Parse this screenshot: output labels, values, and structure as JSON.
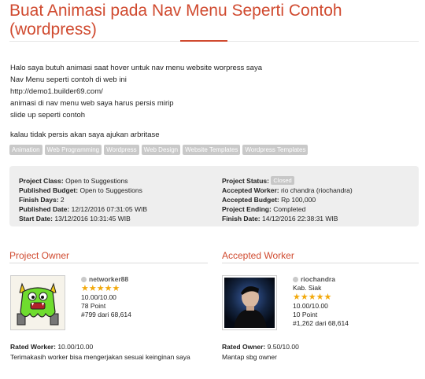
{
  "title": {
    "line1": "Buat Animasi pada Nav Menu Seperti Contoh",
    "line2": "(wordpress)"
  },
  "description": {
    "lines": [
      "Halo saya butuh animasi saat hover untuk nav menu website worpress saya",
      "Nav Menu seperti contoh di web ini",
      "http://demo1.builder69.com/",
      "animasi di nav menu web saya harus persis mirip",
      "slide up seperti contoh"
    ],
    "closing": "kalau tidak persis akan saya ajukan arbritase"
  },
  "tags": [
    "Animation",
    "Web Programming",
    "Wordpress",
    "Web Design",
    "Website Templates",
    "Wordpress Templates"
  ],
  "project_info": {
    "left": [
      {
        "label": "Project Class:",
        "value": "Open to Suggestions"
      },
      {
        "label": "Published Budget:",
        "value": "Open to Suggestions"
      },
      {
        "label": "Finish Days:",
        "value": "2"
      },
      {
        "label": "Published Date:",
        "value": "12/12/2016 07:31:05 WIB"
      },
      {
        "label": "Start Date:",
        "value": "13/12/2016 10:31:45 WIB"
      }
    ],
    "right": [
      {
        "label": "Project Status:",
        "value": "Closed"
      },
      {
        "label": "Accepted Worker:",
        "value": "rio chandra (riochandra)"
      },
      {
        "label": "Accepted Budget:",
        "value": "Rp 100,000"
      },
      {
        "label": "Project Ending:",
        "value": "Completed"
      },
      {
        "label": "Finish Date:",
        "value": "14/12/2016 22:38:31 WIB"
      }
    ]
  },
  "owner": {
    "section_title": "Project Owner",
    "username": "networker88",
    "location": "",
    "stars": "★★★★★",
    "rating": "10.00/10.00",
    "points": "78 Point",
    "rank": "#799 dari 68,614",
    "rated_label": "Rated Worker:",
    "rated_value": "10.00/10.00",
    "comment": "Terimakasih worker bisa mengerjakan sesuai keinginan saya"
  },
  "worker": {
    "section_title": "Accepted Worker",
    "username": "riochandra",
    "location": "Kab. Siak",
    "stars": "★★★★★",
    "rating": "10.00/10.00",
    "points": "10 Point",
    "rank": "#1,262 dari 68,614",
    "rated_label": "Rated Owner:",
    "rated_value": "9.50/10.00",
    "comment": "Mantap sbg owner"
  },
  "colors": {
    "accent": "#d04a2f",
    "tag_bg": "#c9c9c9",
    "panel_bg": "#eeeeee",
    "star": "#f2a90c"
  }
}
